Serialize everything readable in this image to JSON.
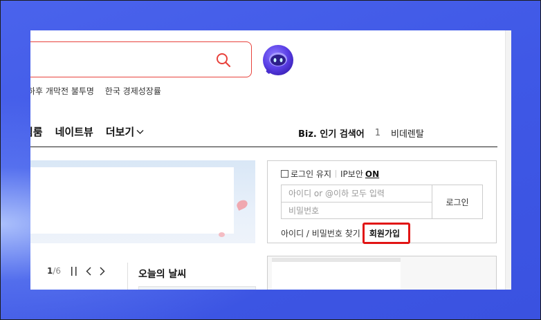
{
  "search": {
    "placeholder": "",
    "suggestions": [
      "하후 개막전 불투명",
      "한국 경제성장률"
    ]
  },
  "nav": {
    "items": [
      "림룸",
      "네이트뷰"
    ],
    "more_label": "더보기"
  },
  "biz": {
    "title": "Biz. 인기 검색어",
    "rank": "1",
    "keyword": "비데렌탈"
  },
  "login": {
    "keep_label": "로그인 유지",
    "ip_label": "IP보안",
    "ip_state": "ON",
    "id_placeholder": "아이디 or @이하 모두 입력",
    "pw_placeholder": "비밀번호",
    "button": "로그인",
    "find_label": "아이디 / 비밀번호 찾기",
    "signup_label": "회원가입"
  },
  "pager": {
    "current": "1",
    "separator": "/",
    "total": "6"
  },
  "weather": {
    "title": "오늘의 날씨"
  },
  "colors": {
    "accent": "#e8413b",
    "highlight": "#e11414",
    "background": "#3e57e6"
  }
}
